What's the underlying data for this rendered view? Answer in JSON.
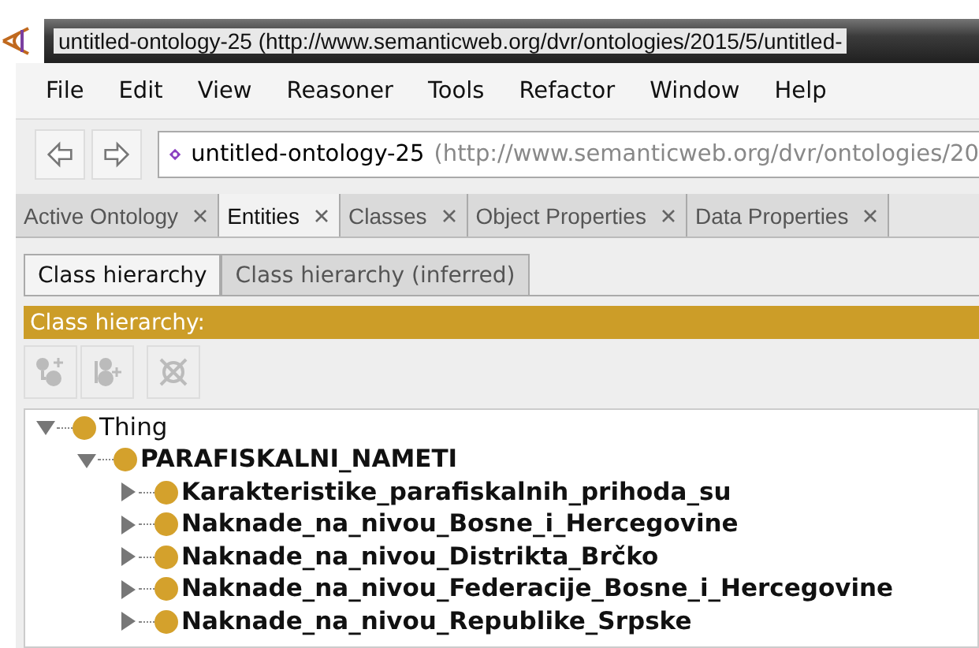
{
  "window": {
    "title": "untitled-ontology-25 (http://www.semanticweb.org/dvr/ontologies/2015/5/untitled-"
  },
  "menu": [
    "File",
    "Edit",
    "View",
    "Reasoner",
    "Tools",
    "Refactor",
    "Window",
    "Help"
  ],
  "address": {
    "name": "untitled-ontology-25",
    "iri": "(http://www.semanticweb.org/dvr/ontologies/20"
  },
  "tabs": [
    {
      "label": "Active Ontology",
      "selected": false
    },
    {
      "label": "Entities",
      "selected": true
    },
    {
      "label": "Classes",
      "selected": false
    },
    {
      "label": "Object Properties",
      "selected": false
    },
    {
      "label": "Data Properties",
      "selected": false
    }
  ],
  "subtabs": [
    {
      "label": "Class hierarchy",
      "selected": true
    },
    {
      "label": "Class hierarchy (inferred)",
      "selected": false
    }
  ],
  "panel_title": "Class hierarchy:",
  "tree": [
    {
      "label": "Thing",
      "bold": false,
      "expanded": true,
      "children": [
        {
          "label": "PARAFISKALNI_NAMETI",
          "bold": true,
          "expanded": true,
          "children": [
            {
              "label": "Karakteristike_parafiskalnih_prihoda_su",
              "bold": true,
              "expanded": false
            },
            {
              "label": "Naknade_na_nivou_Bosne_i_Hercegovine",
              "bold": true,
              "expanded": false
            },
            {
              "label": "Naknade_na_nivou_Distrikta_Brčko",
              "bold": true,
              "expanded": false
            },
            {
              "label": "Naknade_na_nivou_Federacije_Bosne_i_Hercegovine",
              "bold": true,
              "expanded": false
            },
            {
              "label": "Naknade_na_nivou_Republike_Srpske",
              "bold": true,
              "expanded": false
            }
          ]
        }
      ]
    }
  ]
}
